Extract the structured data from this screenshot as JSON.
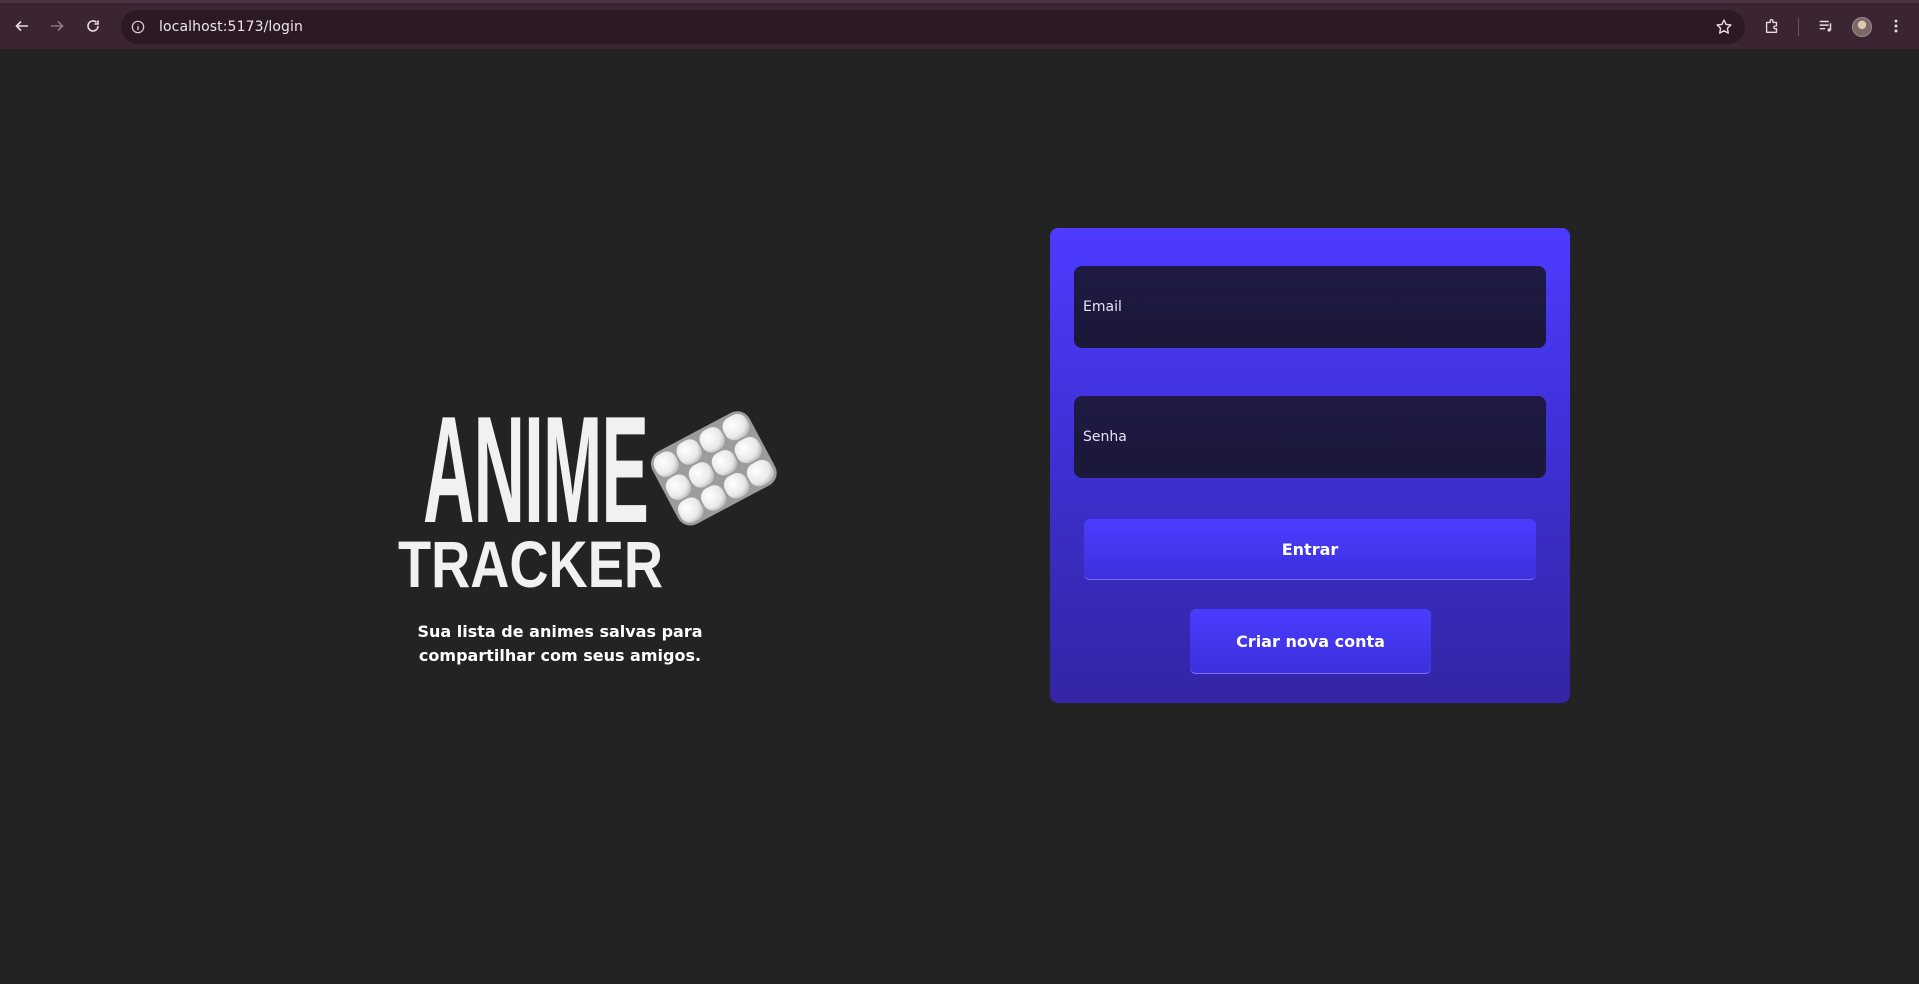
{
  "browser": {
    "url": "localhost:5173/login"
  },
  "logo": {
    "line1": "ANIME",
    "line2": "TRACKER"
  },
  "tagline": {
    "line1": "Sua lista de animes salvas para",
    "line2": "compartilhar com seus amigos."
  },
  "login_form": {
    "email_placeholder": "Email",
    "password_placeholder": "Senha",
    "submit_label": "Entrar",
    "create_account_label": "Criar nova conta"
  },
  "colors": {
    "page_bg": "#232323",
    "card_accent": "#4d3bff",
    "field_bg": "#1e1a44",
    "chrome_bg": "#3b2532"
  }
}
